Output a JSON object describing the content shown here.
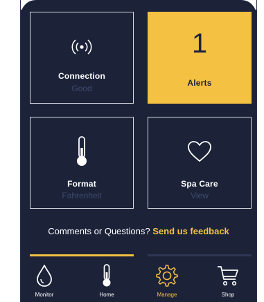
{
  "tiles": {
    "connection": {
      "title": "Connection",
      "status": "Good",
      "icon": "wireless-signal-icon"
    },
    "alerts": {
      "count": "1",
      "title": "Alerts"
    },
    "format": {
      "title": "Format",
      "value": "Fahrenheit",
      "icon": "thermometer-icon"
    },
    "spa_care": {
      "title": "Spa Care",
      "action": "View",
      "icon": "heart-icon"
    }
  },
  "feedback": {
    "prompt": "Comments or Questions?",
    "link": "Send us feedback"
  },
  "tabbar": {
    "active": "Manage",
    "tabs": [
      {
        "label": "Monitor",
        "icon": "water-drop-icon"
      },
      {
        "label": "Home",
        "icon": "thermometer-icon"
      },
      {
        "label": "Manage",
        "icon": "gear-icon"
      },
      {
        "label": "Shop",
        "icon": "shopping-cart-icon"
      }
    ]
  },
  "colors": {
    "background": "#1c2339",
    "accent": "#f4c142",
    "muted_text": "#3e4a6b",
    "tile_border": "#d9dce4"
  }
}
